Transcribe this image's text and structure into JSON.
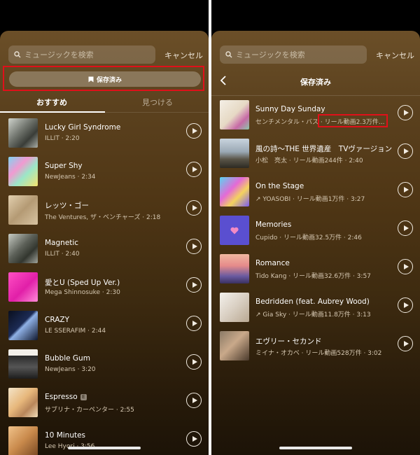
{
  "left": {
    "search_placeholder": "ミュージックを検索",
    "cancel_label": "キャンセル",
    "saved_button_label": "保存済み",
    "tabs": [
      "おすすめ",
      "見つける"
    ],
    "tracks": [
      {
        "title": "Lucky Girl Syndrome",
        "subtitle": "ILLIT · 2:20"
      },
      {
        "title": "Super Shy",
        "subtitle": "NewJeans · 2:34"
      },
      {
        "title": "レッツ・ゴー",
        "subtitle": "The Ventures, ザ・ベンチャーズ · 2:18"
      },
      {
        "title": "Magnetic",
        "subtitle": "ILLIT · 2:40"
      },
      {
        "title": "愛とU (Sped Up Ver.)",
        "subtitle": "Mega Shinnosuke · 2:30"
      },
      {
        "title": "CRAZY",
        "subtitle": "LE SSERAFIM · 2:44"
      },
      {
        "title": "Bubble Gum",
        "subtitle": "NewJeans · 3:20"
      },
      {
        "title": "Espresso",
        "subtitle": "サブリナ・カーペンター · 2:55",
        "badge": "E"
      },
      {
        "title": "10 Minutes",
        "subtitle": "Lee Hyori · 3:56"
      }
    ]
  },
  "right": {
    "search_placeholder": "ミュージックを検索",
    "cancel_label": "キャンセル",
    "header_title": "保存済み",
    "tracks": [
      {
        "title": "Sunny Day Sunday",
        "subtitle": "センチメンタル・バス · リール動画2.3万件..."
      },
      {
        "title": "風の詩〜THE 世界遺産　TVヴァージョン",
        "subtitle": "小松　亮太 · リール動画244件 · 2:40"
      },
      {
        "title": "On the Stage",
        "subtitle": "↗ YOASOBI · リール動画1万件 · 3:27"
      },
      {
        "title": "Memories",
        "subtitle": "Cupido · リール動画32.5万件 · 2:46"
      },
      {
        "title": "Romance",
        "subtitle": "Tido Kang · リール動画32.6万件 · 3:57"
      },
      {
        "title": "Bedridden (feat. Aubrey Wood)",
        "subtitle": "↗ Gia Sky · リール動画11.8万件 · 3:13"
      },
      {
        "title": "エヴリー・セカンド",
        "subtitle": "ミイナ・オカベ · リール動画528万件 · 3:02"
      }
    ]
  },
  "colors": {
    "highlight": "#e0101a",
    "sheet_top": "#6b4f28",
    "saved_button": "#8a775a"
  }
}
